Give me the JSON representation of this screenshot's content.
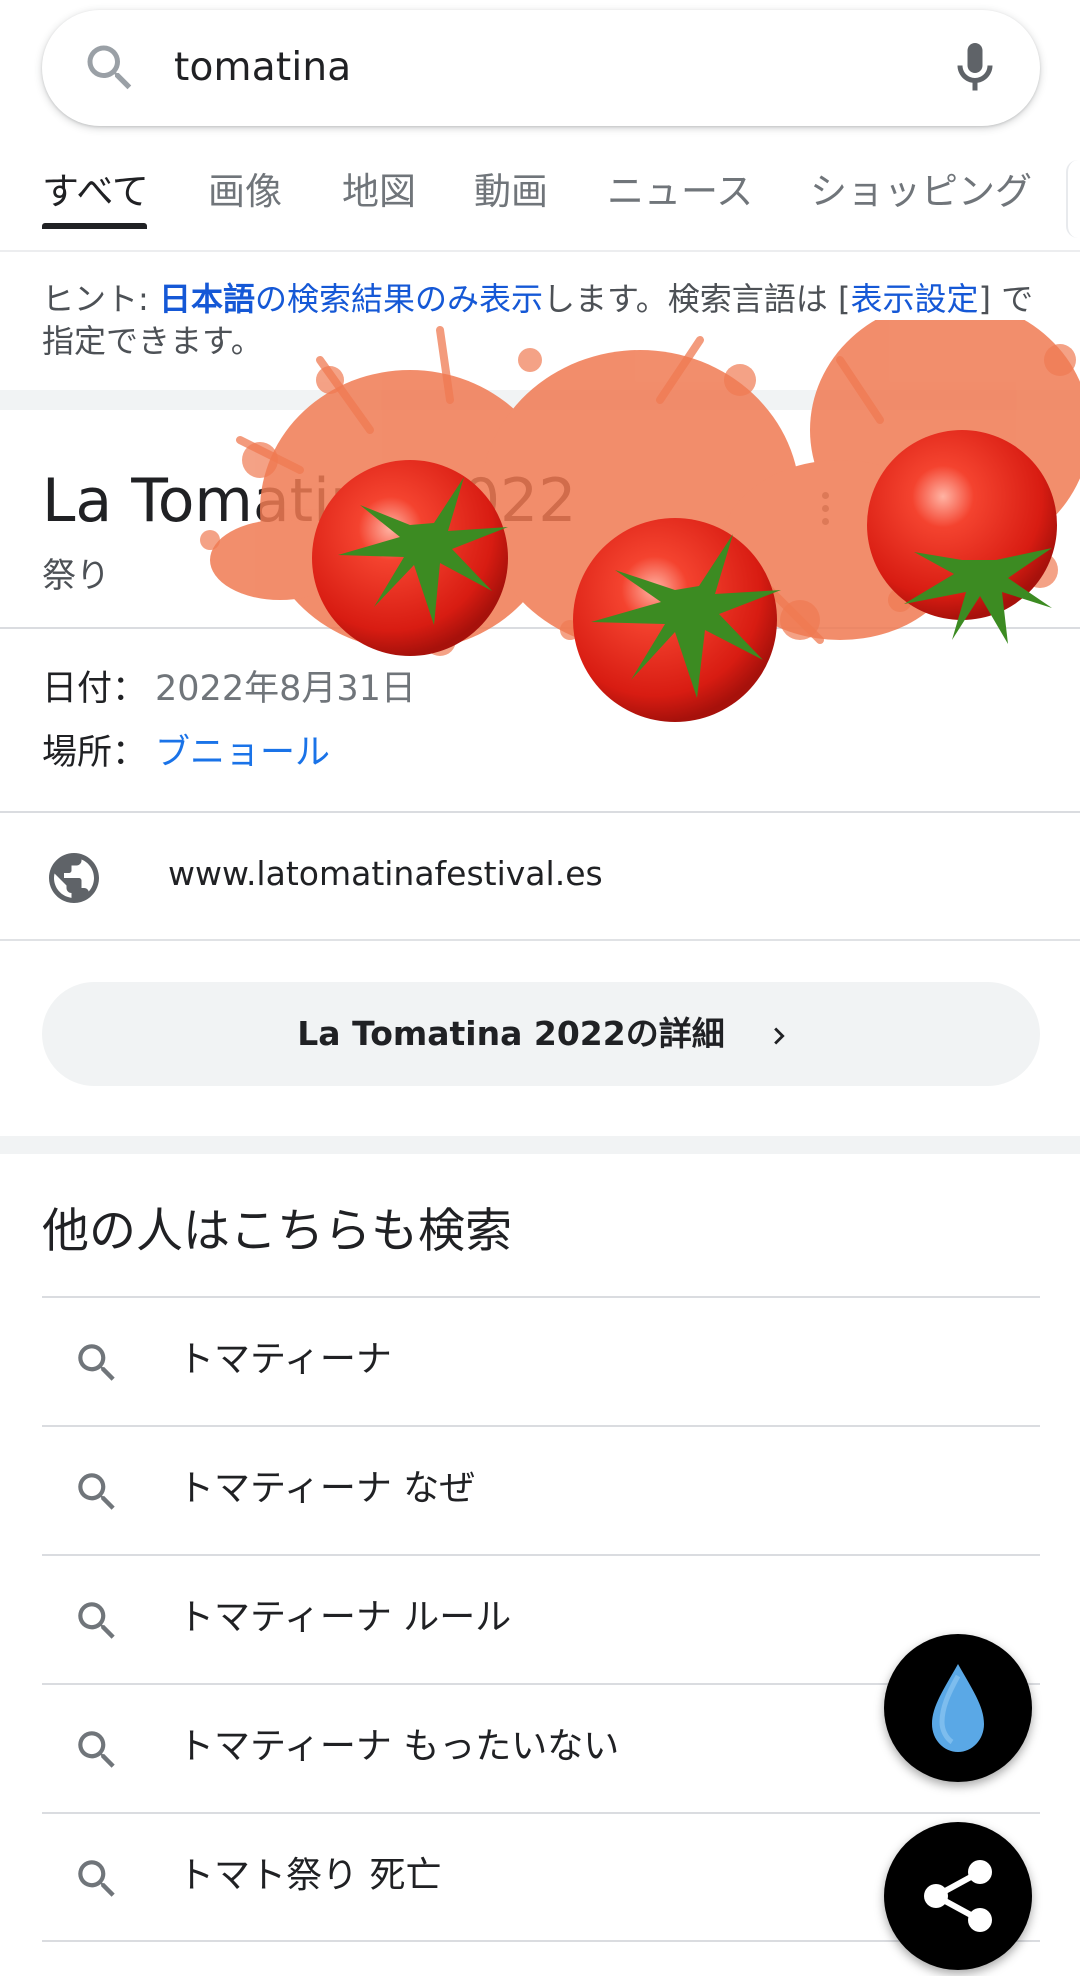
{
  "search": {
    "query": "tomatina"
  },
  "tabs": [
    {
      "label": "すべて",
      "active": true
    },
    {
      "label": "画像"
    },
    {
      "label": "地図"
    },
    {
      "label": "動画"
    },
    {
      "label": "ニュース"
    },
    {
      "label": "ショッピング"
    }
  ],
  "hint": {
    "prefix": "ヒント: ",
    "lang_link": "日本語",
    "link2": "の検索結果のみ表示",
    "middle": "します。検索言語は [",
    "settings_link": "表示設定",
    "suffix": "] で指定できます。"
  },
  "knowledge_panel": {
    "title": "La Tomatina 2022",
    "subtitle": "祭り",
    "date_label": "日付：",
    "date_value": "2022年8月31日",
    "place_label": "場所：",
    "place_value": "ブニョール",
    "website": "www.latomatinafestival.es",
    "details_button": "La Tomatina 2022の詳細"
  },
  "related": {
    "title": "他の人はこちらも検索",
    "items": [
      "トマティーナ",
      "トマティーナ なぜ",
      "トマティーナ ルール",
      "トマティーナ もったいない",
      "トマト祭り 死亡"
    ]
  },
  "colors": {
    "accent": "#1a73e8",
    "tomato": "#e8261c",
    "splash": "#f07a52",
    "drop": "#5aa8e6"
  },
  "icons": {
    "search": "search-icon",
    "mic": "microphone-icon",
    "globe": "globe-icon",
    "more": "more-vert-icon",
    "chevron": "chevron-right-icon",
    "drop": "water-drop-icon",
    "share": "share-icon"
  }
}
